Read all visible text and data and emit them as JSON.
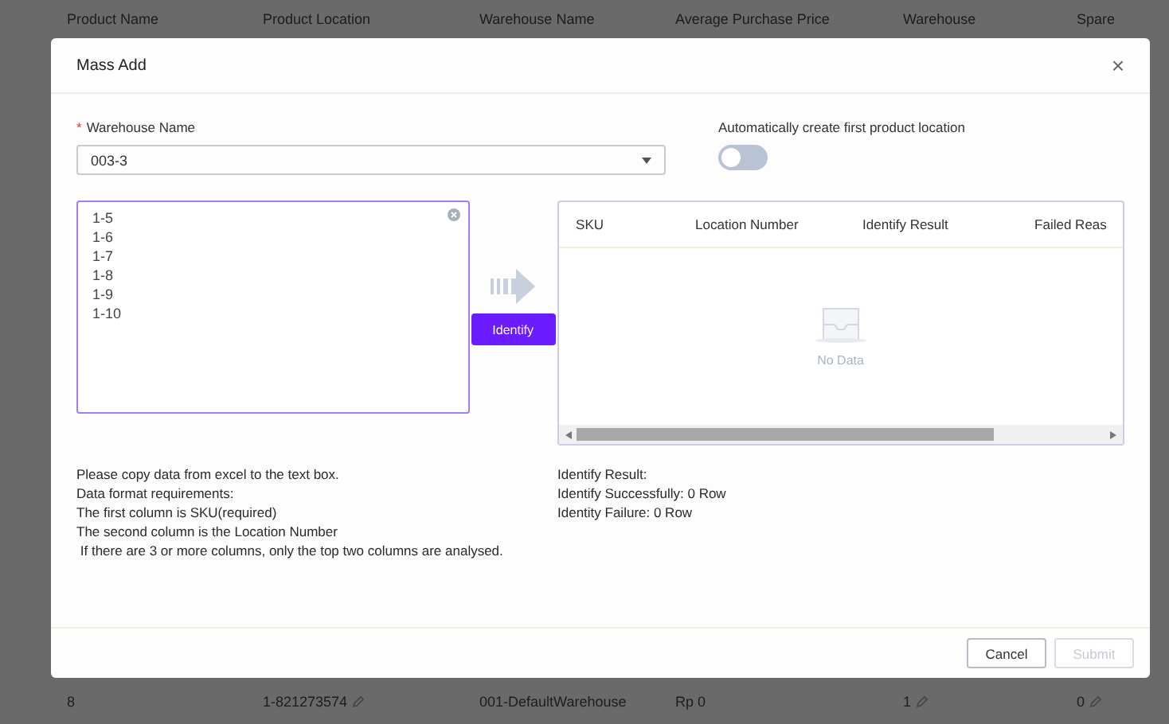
{
  "background_table": {
    "columns": [
      "Product Name",
      "Product Location",
      "Warehouse Name",
      "Average Purchase Price",
      "Warehouse",
      "Spare"
    ],
    "row": [
      {
        "text": "8",
        "editable": false
      },
      {
        "text": "1-821273574",
        "editable": true
      },
      {
        "text": "001-DefaultWarehouse",
        "editable": false
      },
      {
        "text": "Rp 0",
        "editable": false
      },
      {
        "text": "1",
        "editable": true
      },
      {
        "text": "0",
        "editable": true
      }
    ]
  },
  "dialog": {
    "title": "Mass Add",
    "close": "×",
    "warehouse_field": {
      "label": "Warehouse Name",
      "required": "*",
      "value": "003-3"
    },
    "auto_create": {
      "label": "Automatically create first product location",
      "on": false
    },
    "input_lines": [
      "1-5",
      "1-6",
      "1-7",
      "1-8",
      "1-9",
      "1-10"
    ],
    "identify_button": "Identify",
    "result_table": {
      "columns": [
        "SKU",
        "Location Number",
        "Identify Result",
        "Failed Reas"
      ],
      "empty_text": "No Data"
    },
    "instructions": [
      "Please copy data from excel to the text box.",
      "Data format requirements:",
      "The first column is SKU(required)",
      "The second column is the Location Number",
      " If there are 3 or more columns, only the top two columns are analysed."
    ],
    "result_summary": [
      "Identify Result:",
      "Identify Successfully: 0 Row",
      "Identity Failure: 0 Row"
    ],
    "buttons": [
      {
        "label": "Cancel",
        "disabled": false
      },
      {
        "label": "Submit",
        "disabled": true
      }
    ]
  }
}
